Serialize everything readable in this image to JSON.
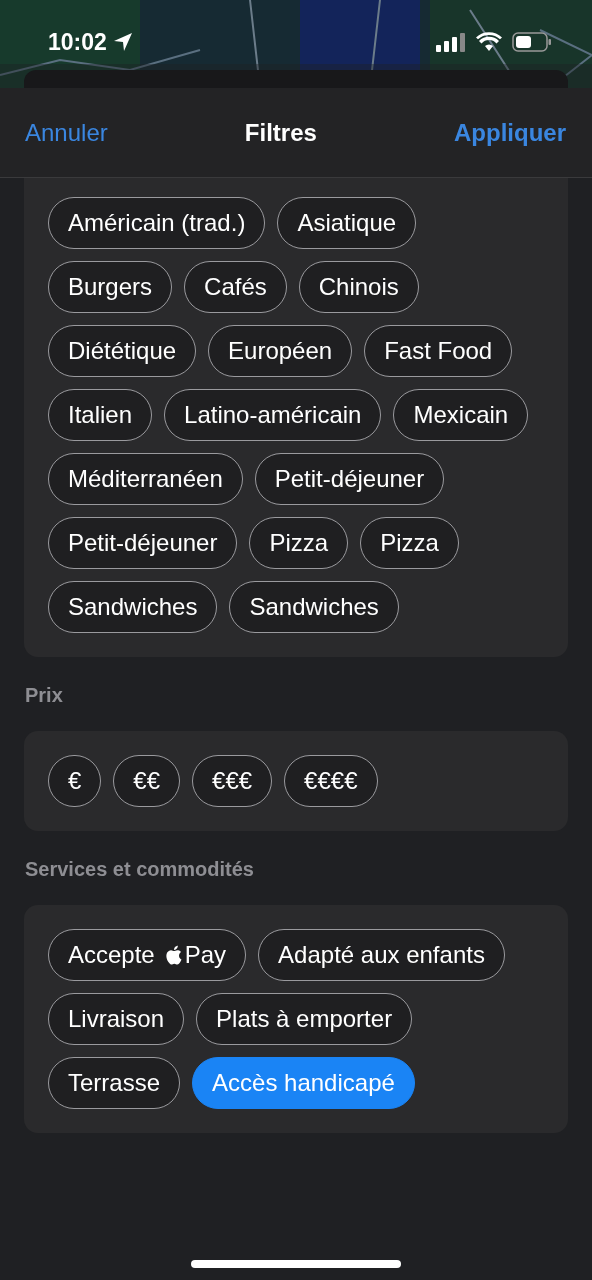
{
  "status_bar": {
    "time": "10:02"
  },
  "header": {
    "cancel": "Annuler",
    "title": "Filtres",
    "apply": "Appliquer"
  },
  "sections": [
    {
      "chips": [
        {
          "label": "Américain (trad.)",
          "selected": false
        },
        {
          "label": "Asiatique",
          "selected": false
        },
        {
          "label": "Burgers",
          "selected": false
        },
        {
          "label": "Cafés",
          "selected": false
        },
        {
          "label": "Chinois",
          "selected": false
        },
        {
          "label": "Diététique",
          "selected": false
        },
        {
          "label": "Européen",
          "selected": false
        },
        {
          "label": "Fast Food",
          "selected": false
        },
        {
          "label": "Italien",
          "selected": false
        },
        {
          "label": "Latino-américain",
          "selected": false
        },
        {
          "label": "Mexicain",
          "selected": false
        },
        {
          "label": "Méditerranéen",
          "selected": false
        },
        {
          "label": "Petit-déjeuner",
          "selected": false
        },
        {
          "label": "Petit-déjeuner",
          "selected": false
        },
        {
          "label": "Pizza",
          "selected": false
        },
        {
          "label": "Pizza",
          "selected": false
        },
        {
          "label": "Sandwiches",
          "selected": false
        },
        {
          "label": "Sandwiches",
          "selected": false
        }
      ]
    },
    {
      "title": "Prix",
      "chips": [
        {
          "label": "€",
          "selected": false
        },
        {
          "label": "€€",
          "selected": false
        },
        {
          "label": "€€€",
          "selected": false
        },
        {
          "label": "€€€€",
          "selected": false
        }
      ]
    },
    {
      "title": "Services et commodités",
      "chips": [
        {
          "kind": "applepay",
          "label": "Accepte",
          "suffix": "Pay",
          "selected": false
        },
        {
          "label": "Adapté aux enfants",
          "selected": false
        },
        {
          "label": "Livraison",
          "selected": false
        },
        {
          "label": "Plats à emporter",
          "selected": false
        },
        {
          "label": "Terrasse",
          "selected": false
        },
        {
          "label": "Accès handicapé",
          "selected": true
        }
      ]
    }
  ]
}
